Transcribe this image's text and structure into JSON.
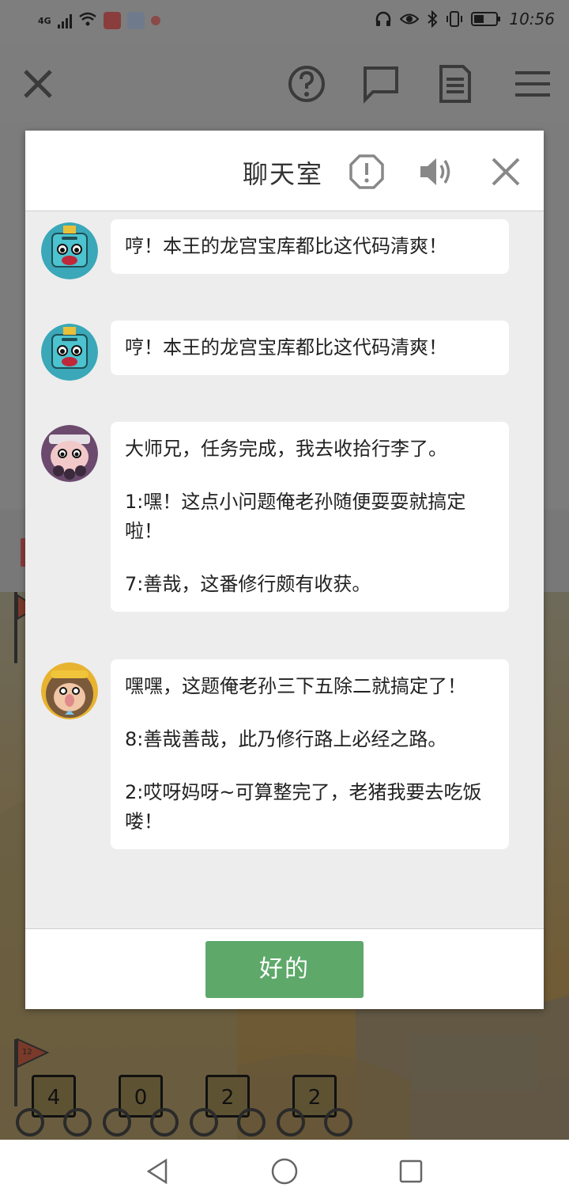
{
  "status_bar": {
    "network": "4G",
    "time": "10:56"
  },
  "dialog": {
    "title": "聊天室",
    "ok_label": "好的",
    "messages": [
      {
        "avatar": "dragon-king-avatar",
        "lines": [
          "哼！本王的龙宫宝库都比这代码清爽！"
        ]
      },
      {
        "avatar": "dragon-king-avatar",
        "lines": [
          "哼！本王的龙宫宝库都比这代码清爽！"
        ]
      },
      {
        "avatar": "pigsy-avatar",
        "lines": [
          "大师兄，任务完成，我去收拾行李了。",
          "1:嘿！这点小问题俺老孙随便耍耍就搞定啦！",
          "7:善哉，这番修行颇有收获。"
        ]
      },
      {
        "avatar": "monkey-king-avatar",
        "lines": [
          "嘿嘿，这题俺老孙三下五除二就搞定了！",
          "8:善哉善哉，此乃修行路上必经之路。",
          "2:哎呀妈呀~可算整完了，老猪我要去吃饭喽！"
        ]
      }
    ]
  },
  "counters": [
    "4",
    "0",
    "2",
    "2"
  ],
  "flag_label": "12",
  "colors": {
    "ok_button": "#5ea86a",
    "chat_background": "#ededed",
    "bubble": "#ffffff"
  }
}
